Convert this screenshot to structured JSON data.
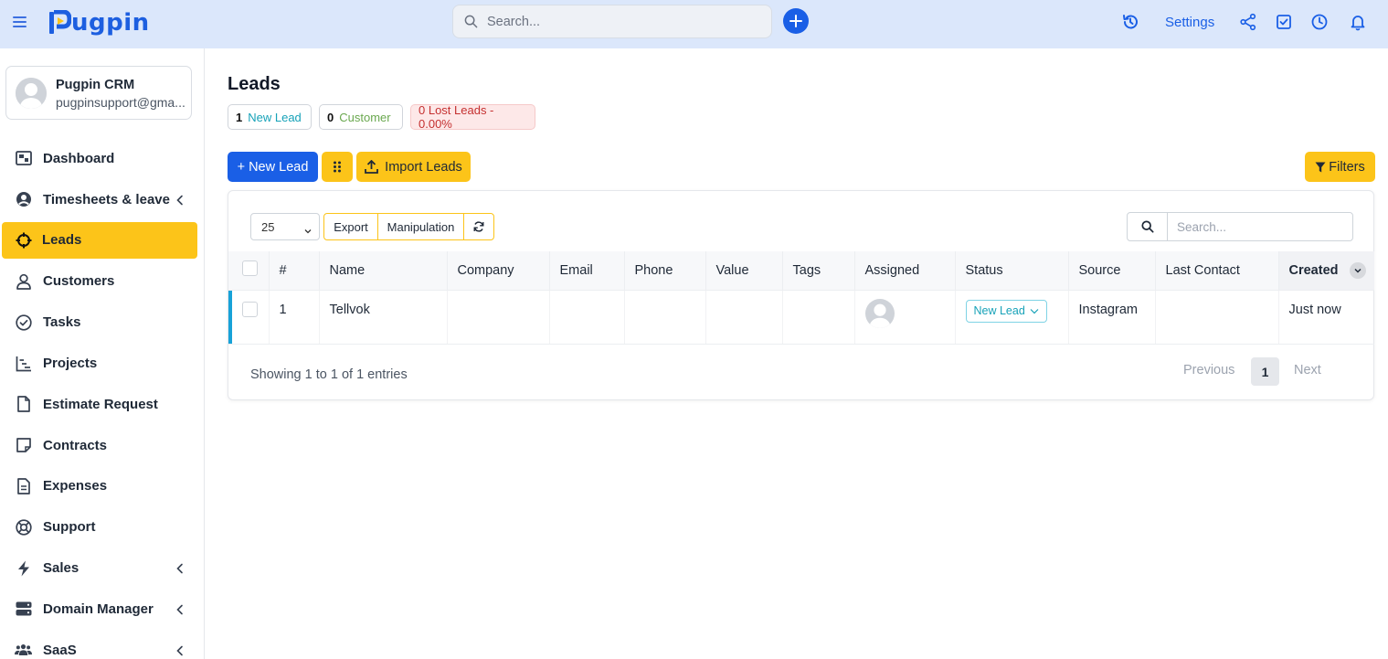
{
  "topbar": {
    "logo_text": "ugpin",
    "search_placeholder": "Search...",
    "settings_label": "Settings"
  },
  "profile": {
    "name": "Pugpin CRM",
    "email": "pugpinsupport@gma..."
  },
  "sidebar": {
    "items": [
      {
        "label": "Dashboard",
        "icon": "dashboard-icon",
        "has_chevron": false
      },
      {
        "label": "Timesheets & leave",
        "icon": "user-circle-icon",
        "has_chevron": true
      },
      {
        "label": "Leads",
        "icon": "crosshair-icon",
        "has_chevron": false,
        "active": true
      },
      {
        "label": "Customers",
        "icon": "user-icon",
        "has_chevron": false
      },
      {
        "label": "Tasks",
        "icon": "check-circle-icon",
        "has_chevron": false
      },
      {
        "label": "Projects",
        "icon": "gantt-icon",
        "has_chevron": false
      },
      {
        "label": "Estimate Request",
        "icon": "file-icon",
        "has_chevron": false
      },
      {
        "label": "Contracts",
        "icon": "sticky-note-icon",
        "has_chevron": false
      },
      {
        "label": "Expenses",
        "icon": "file-text-icon",
        "has_chevron": false
      },
      {
        "label": "Support",
        "icon": "life-ring-icon",
        "has_chevron": false
      },
      {
        "label": "Sales",
        "icon": "bolt-icon",
        "has_chevron": true
      },
      {
        "label": "Domain Manager",
        "icon": "server-icon",
        "has_chevron": true
      },
      {
        "label": "SaaS",
        "icon": "users-icon",
        "has_chevron": true
      }
    ]
  },
  "page": {
    "title": "Leads",
    "stats": {
      "new_lead_count": "1",
      "new_lead_label": "New Lead",
      "customer_count": "0",
      "customer_label": "Customer",
      "lost_label": "0 Lost Leads - 0.00%"
    },
    "buttons": {
      "new_lead": "+ New Lead",
      "import_leads": "Import Leads",
      "filters": "Filters"
    }
  },
  "table": {
    "page_size": "25",
    "tools": {
      "export": "Export",
      "manipulation": "Manipulation"
    },
    "search_placeholder": "Search...",
    "columns": [
      "#",
      "Name",
      "Company",
      "Email",
      "Phone",
      "Value",
      "Tags",
      "Assigned",
      "Status",
      "Source",
      "Last Contact",
      "Created"
    ],
    "rows": [
      {
        "num": "1",
        "name": "Tellvok",
        "company": "",
        "email": "",
        "phone": "",
        "value": "",
        "tags": "",
        "status": "New Lead",
        "source": "Instagram",
        "last_contact": "",
        "created": "Just now"
      }
    ],
    "showing": "Showing 1 to 1 of 1 entries",
    "pagination": {
      "previous": "Previous",
      "current": "1",
      "next": "Next"
    }
  },
  "colors": {
    "primary": "#1a5fe6",
    "accent_yellow": "#fcc419",
    "topbar_bg": "#dbe7fb",
    "status_teal": "#17a2b8",
    "lost_red": "#c53030",
    "customer_green": "#6aa84f"
  }
}
